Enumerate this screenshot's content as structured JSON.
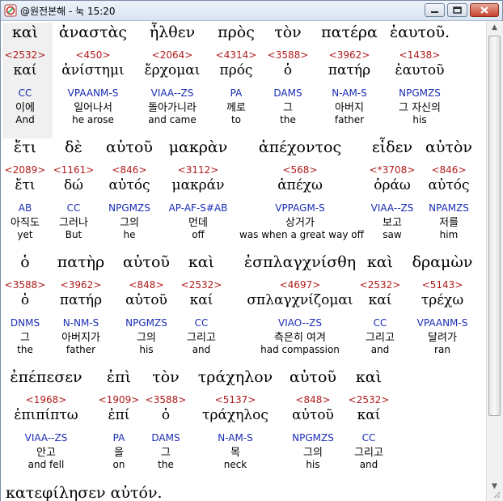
{
  "window": {
    "title": "@원전본해 - 눅 15:20",
    "minimize_symbol": "‒",
    "maximize_symbol": "□",
    "close_symbol": "✕"
  },
  "lines": [
    {
      "words": [
        {
          "greek": "καὶ",
          "strong": "<2532>",
          "lemma": "καί",
          "parse": "CC",
          "korean": "이에",
          "english": "And"
        },
        {
          "greek": "ἀναστὰς",
          "strong": "<450>",
          "lemma": "ἀνίστημι",
          "parse": "VPAANM-S",
          "korean": "일어나서",
          "english": "he arose"
        },
        {
          "greek": "ἦλθεν",
          "strong": "<2064>",
          "lemma": "ἔρχομαι",
          "parse": "VIAA--ZS",
          "korean": "돌아가니라",
          "english": "and came"
        },
        {
          "greek": "πρὸς",
          "strong": "<4314>",
          "lemma": "πρός",
          "parse": "PA",
          "korean": "께로",
          "english": "to"
        },
        {
          "greek": "τὸν",
          "strong": "<3588>",
          "lemma": "ὁ",
          "parse": "DAMS",
          "korean": "그",
          "english": "the"
        },
        {
          "greek": "πατέρα",
          "strong": "<3962>",
          "lemma": "πατήρ",
          "parse": "N-AM-S",
          "korean": "아버지",
          "english": "father"
        },
        {
          "greek": "ἑαυτοῦ.",
          "strong": "<1438>",
          "lemma": "ἑαυτοῦ",
          "parse": "NPGMZS",
          "korean": "그 자신의",
          "english": "his"
        }
      ]
    },
    {
      "words": [
        {
          "greek": "ἔτι",
          "strong": "<2089>",
          "lemma": "ἔτι",
          "parse": "AB",
          "korean": "아직도",
          "english": "yet"
        },
        {
          "greek": "δὲ",
          "strong": "<1161>",
          "lemma": "δώ",
          "parse": "CC",
          "korean": "그러나",
          "english": "But"
        },
        {
          "greek": "αὐτοῦ",
          "strong": "<846>",
          "lemma": "αὐτός",
          "parse": "NPGMZS",
          "korean": "그의",
          "english": "he"
        },
        {
          "greek": "μακρὰν",
          "strong": "<3112>",
          "lemma": "μακράν",
          "parse": "AP-AF-S#AB",
          "korean": "먼데",
          "english": "off"
        },
        {
          "greek": "ἀπέχοντος",
          "strong": "<568>",
          "lemma": "ἀπέχω",
          "parse": "VPPAGM-S",
          "korean": "상거가",
          "english": "was when a great way off"
        },
        {
          "greek": "εἶδεν",
          "strong": "<*3708>",
          "lemma": "ὁράω",
          "parse": "VIAA--ZS",
          "korean": "보고",
          "english": "saw"
        },
        {
          "greek": "αὐτὸν",
          "strong": "<846>",
          "lemma": "αὐτός",
          "parse": "NPAMZS",
          "korean": "저를",
          "english": "him"
        }
      ]
    },
    {
      "words": [
        {
          "greek": "ὁ",
          "strong": "<3588>",
          "lemma": "ὁ",
          "parse": "DNMS",
          "korean": "그",
          "english": "the"
        },
        {
          "greek": "πατὴρ",
          "strong": "<3962>",
          "lemma": "πατήρ",
          "parse": "N-NM-S",
          "korean": "아버지가",
          "english": "father"
        },
        {
          "greek": "αὐτοῦ",
          "strong": "<848>",
          "lemma": "αὐτοῦ",
          "parse": "NPGMZS",
          "korean": "그의",
          "english": "his"
        },
        {
          "greek": "καὶ",
          "strong": "<2532>",
          "lemma": "καί",
          "parse": "CC",
          "korean": "그리고",
          "english": "and"
        },
        {
          "greek": "ἐσπλαγχνίσθη",
          "strong": "<4697>",
          "lemma": "σπλαγχνίζομαι",
          "parse": "VIAO--ZS",
          "korean": "측은히 여겨",
          "english": "had compassion"
        },
        {
          "greek": "καὶ",
          "strong": "<2532>",
          "lemma": "καί",
          "parse": "CC",
          "korean": "그리고",
          "english": "and"
        },
        {
          "greek": "δραμὼν",
          "strong": "<5143>",
          "lemma": "τρέχω",
          "parse": "VPAANM-S",
          "korean": "달려가",
          "english": "ran"
        }
      ]
    },
    {
      "words": [
        {
          "greek": "ἐπέπεσεν",
          "strong": "<1968>",
          "lemma": "ἐπιπίπτω",
          "parse": "VIAA--ZS",
          "korean": "안고",
          "english": "and fell"
        },
        {
          "greek": "ἐπὶ",
          "strong": "<1909>",
          "lemma": "ἐπί",
          "parse": "PA",
          "korean": "을",
          "english": "on"
        },
        {
          "greek": "τὸν",
          "strong": "<3588>",
          "lemma": "ὁ",
          "parse": "DAMS",
          "korean": "그",
          "english": "the"
        },
        {
          "greek": "τράχηλον",
          "strong": "<5137>",
          "lemma": "τράχηλος",
          "parse": "N-AM-S",
          "korean": "목",
          "english": "neck"
        },
        {
          "greek": "αὐτοῦ",
          "strong": "<848>",
          "lemma": "αὐτοῦ",
          "parse": "NPGMZS",
          "korean": "그의",
          "english": "his"
        },
        {
          "greek": "καὶ",
          "strong": "<2532>",
          "lemma": "καί",
          "parse": "CC",
          "korean": "그리고",
          "english": "and"
        }
      ]
    }
  ],
  "partial_next_line": "κατεφίλησεν αὐτόν.",
  "scrollbar": {
    "up_arrow": "▲",
    "down_arrow": "▼"
  }
}
